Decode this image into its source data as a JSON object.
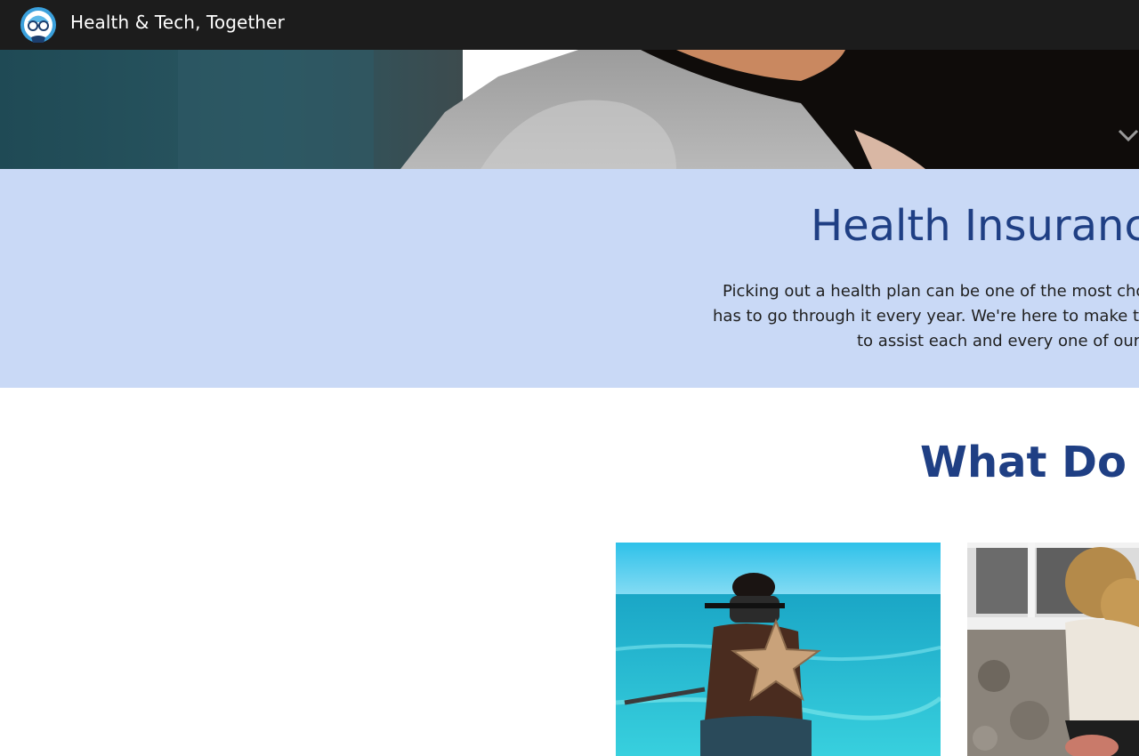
{
  "header": {
    "brand": "Health & Tech, Together",
    "logo_icon": "glasses-mascot-icon"
  },
  "hero": {
    "scroll_icon": "chevron-down-icon"
  },
  "intro": {
    "title": "Health Insuranc",
    "lines": [
      "Picking out a health plan can be one of the most cho",
      "has to go through it every year. We're here to make th",
      "to assist each and every one of our"
    ]
  },
  "services": {
    "title": "What Do W"
  },
  "colors": {
    "topbar": "#1c1c1c",
    "intro_background": "#c9d9f6",
    "heading": "#1f3f84"
  }
}
